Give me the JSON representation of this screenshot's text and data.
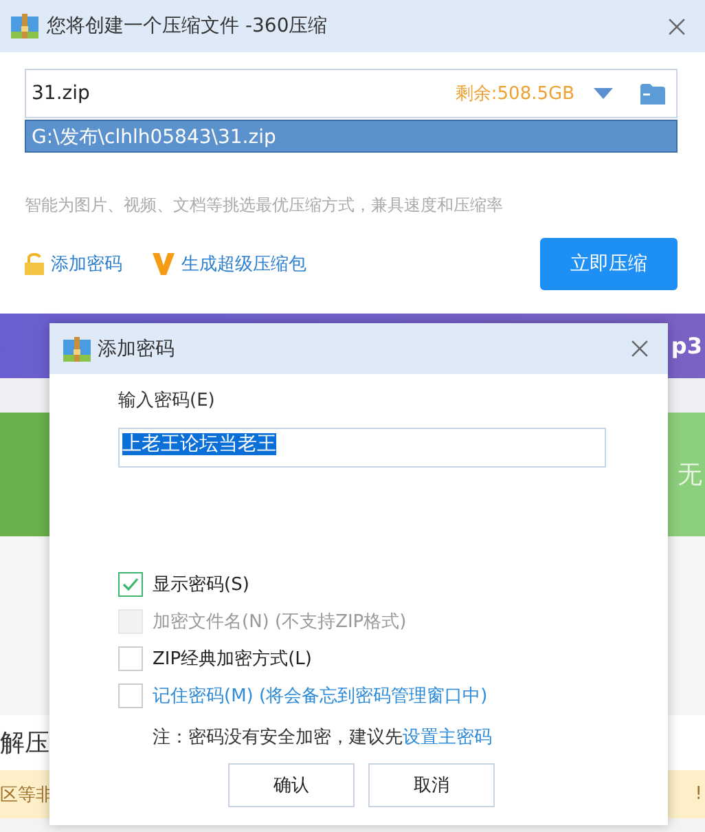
{
  "main_window": {
    "title": "您将创建一个压缩文件 -360压缩",
    "file_name": "31.zip",
    "free_space": "剩余:508.5GB",
    "path_suggestion": "G:\\发布\\clhlh05843\\31.zip",
    "hint": "智能为图片、视频、文档等挑选最优压缩方式，兼具速度和压缩率",
    "add_password": "添加密码",
    "super_package": "生成超级压缩包",
    "compress_button": "立即压缩"
  },
  "background": {
    "banner_text": "p3",
    "green_text": "无",
    "section_title": "解压",
    "notice_left": "区等非",
    "notice_right": "!"
  },
  "dialog": {
    "title": "添加密码",
    "password_label": "输入密码(E)",
    "password_value": "上老王论坛当老王",
    "options": [
      {
        "label": "显示密码(S)",
        "checked": true,
        "disabled": false,
        "kind": "plain"
      },
      {
        "label": "加密文件名(N) (不支持ZIP格式)",
        "checked": false,
        "disabled": true,
        "kind": "plain"
      },
      {
        "label": "ZIP经典加密方式(L)",
        "checked": false,
        "disabled": false,
        "kind": "plain"
      },
      {
        "label": "记住密码(M) (将会备忘到密码管理窗口中)",
        "checked": false,
        "disabled": false,
        "kind": "link"
      }
    ],
    "note": "注：密码没有安全加密，建议先",
    "note_link": "设置主密码",
    "buttons": [
      "确认",
      "取消"
    ]
  }
}
